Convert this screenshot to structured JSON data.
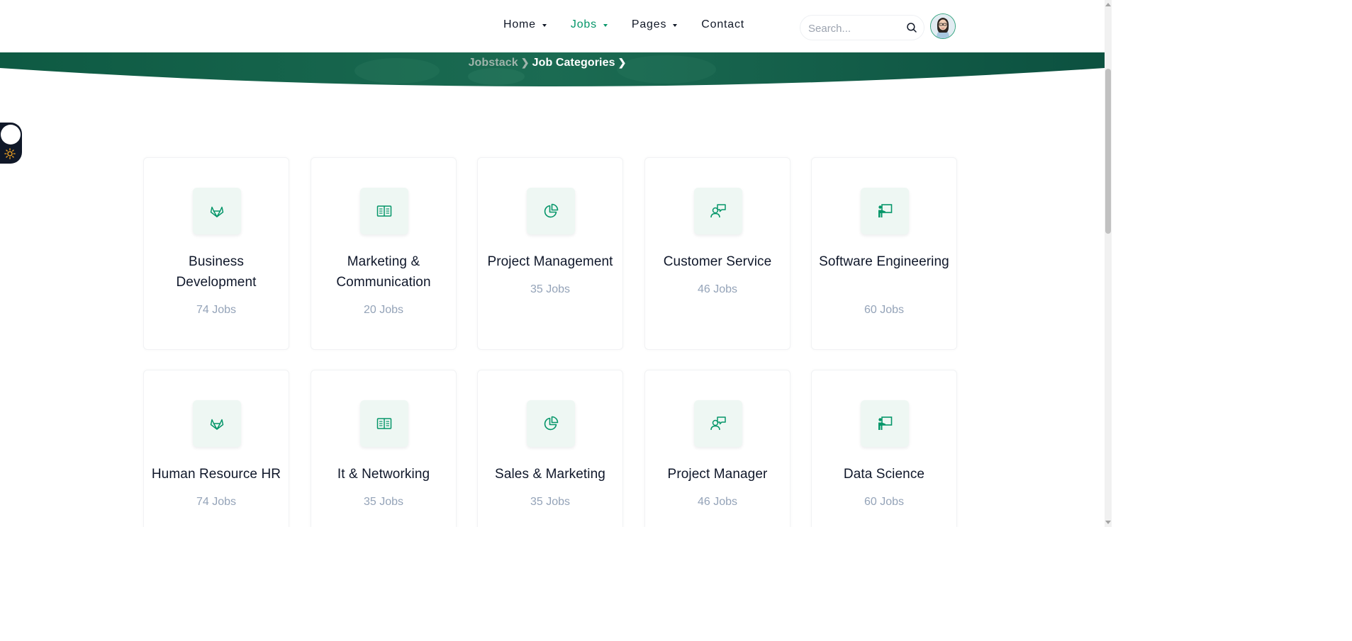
{
  "nav": {
    "items": [
      {
        "label": "Home",
        "has_dropdown": true,
        "active": false
      },
      {
        "label": "Jobs",
        "has_dropdown": true,
        "active": true
      },
      {
        "label": "Pages",
        "has_dropdown": true,
        "active": false
      },
      {
        "label": "Contact",
        "has_dropdown": false,
        "active": false
      }
    ],
    "search": {
      "placeholder": "Search...",
      "value": "",
      "icon": "search-icon"
    },
    "avatar": {
      "icon": "user-avatar"
    }
  },
  "breadcrumb": {
    "root": "Jobstack",
    "current": "Job Categories"
  },
  "theme_toggle": {
    "icon": "sun-icon"
  },
  "colors": {
    "brand": "#059669",
    "hero_dark": "#0b4d3a",
    "icon_bg": "#eef7f3",
    "count_text": "#94a3b8"
  },
  "categories": [
    {
      "title": "Business Development",
      "count": "74 Jobs",
      "icon": "gitlab-icon"
    },
    {
      "title": "Marketing & Communication",
      "count": "20 Jobs",
      "icon": "book-open-icon"
    },
    {
      "title": "Project Management",
      "count": "35 Jobs",
      "icon": "pie-chart-icon"
    },
    {
      "title": "Customer Service",
      "count": "46 Jobs",
      "icon": "user-message-icon"
    },
    {
      "title": "Software Engineering",
      "count": "60 Jobs",
      "icon": "presentation-icon"
    },
    {
      "title": "Human Resource HR",
      "count": "74 Jobs",
      "icon": "gitlab-icon"
    },
    {
      "title": "It & Networking",
      "count": "35 Jobs",
      "icon": "book-open-icon"
    },
    {
      "title": "Sales & Marketing",
      "count": "35 Jobs",
      "icon": "pie-chart-icon"
    },
    {
      "title": "Project Manager",
      "count": "46 Jobs",
      "icon": "user-message-icon"
    },
    {
      "title": "Data Science",
      "count": "60 Jobs",
      "icon": "presentation-icon"
    }
  ]
}
